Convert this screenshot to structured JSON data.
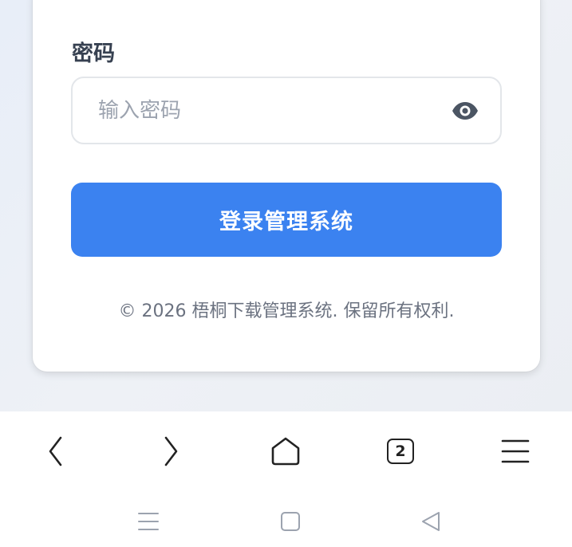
{
  "login": {
    "password_label": "密码",
    "password_placeholder": "输入密码",
    "submit_label": "登录管理系统",
    "footer": "© 2026 梧桐下载管理系统. 保留所有权利."
  },
  "browser_toolbar": {
    "tab_count": "2",
    "icons": [
      "chevron-left-icon",
      "chevron-right-icon",
      "home-icon",
      "tabs-icon",
      "menu-icon"
    ]
  },
  "system_nav": {
    "icons": [
      "recents-icon",
      "home-square-icon",
      "back-triangle-icon"
    ]
  },
  "colors": {
    "primary": "#3b82f0",
    "label": "#374151",
    "placeholder": "#9ca3af",
    "footer": "#6b7280"
  }
}
